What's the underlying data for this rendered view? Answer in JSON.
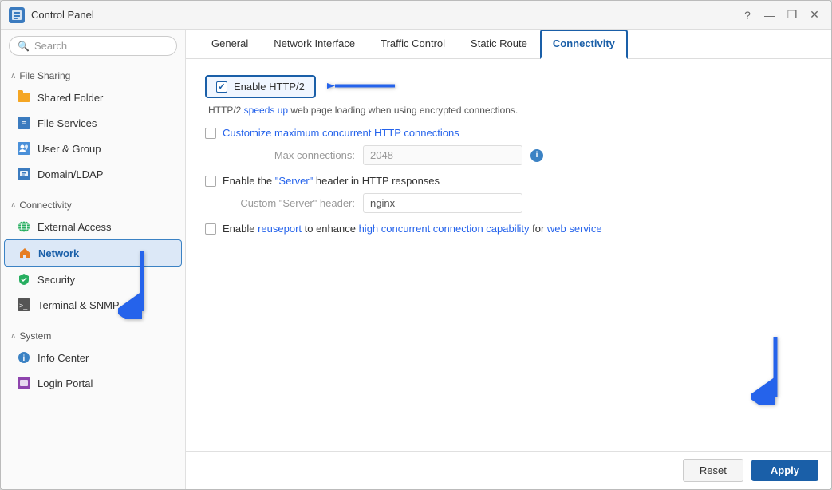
{
  "window": {
    "title": "Control Panel"
  },
  "titlebar_controls": {
    "help": "?",
    "minimize": "—",
    "maximize": "❐",
    "close": "✕"
  },
  "sidebar": {
    "search_placeholder": "Search",
    "sections": [
      {
        "label": "File Sharing",
        "expanded": true,
        "items": [
          {
            "id": "shared-folder",
            "label": "Shared Folder",
            "icon": "folder"
          },
          {
            "id": "file-services",
            "label": "File Services",
            "icon": "file-services"
          },
          {
            "id": "user-group",
            "label": "User & Group",
            "icon": "users"
          },
          {
            "id": "domain-ldap",
            "label": "Domain/LDAP",
            "icon": "domain"
          }
        ]
      },
      {
        "label": "Connectivity",
        "expanded": true,
        "items": [
          {
            "id": "external-access",
            "label": "External Access",
            "icon": "globe"
          },
          {
            "id": "network",
            "label": "Network",
            "icon": "house",
            "active": true
          },
          {
            "id": "security",
            "label": "Security",
            "icon": "shield"
          },
          {
            "id": "terminal-snmp",
            "label": "Terminal & SNMP",
            "icon": "terminal"
          }
        ]
      },
      {
        "label": "System",
        "expanded": true,
        "items": [
          {
            "id": "info-center",
            "label": "Info Center",
            "icon": "info"
          },
          {
            "id": "login-portal",
            "label": "Login Portal",
            "icon": "login"
          }
        ]
      }
    ]
  },
  "tabs": [
    {
      "id": "general",
      "label": "General",
      "active": false
    },
    {
      "id": "network-interface",
      "label": "Network Interface",
      "active": false
    },
    {
      "id": "traffic-control",
      "label": "Traffic Control",
      "active": false
    },
    {
      "id": "static-route",
      "label": "Static Route",
      "active": false
    },
    {
      "id": "connectivity",
      "label": "Connectivity",
      "active": true
    }
  ],
  "content": {
    "enable_http2": {
      "label": "Enable HTTP/2",
      "checked": true
    },
    "http2_description": "HTTP/2 speeds up web page loading when using encrypted connections.",
    "http2_description_highlight": "speeds up",
    "customize_http": {
      "label": "Customize maximum concurrent HTTP connections",
      "checked": false
    },
    "max_connections": {
      "label": "Max connections:",
      "value": "2048"
    },
    "server_header": {
      "label": "Enable the \"Server\" header in HTTP responses",
      "checked": false,
      "label_highlight": "Server"
    },
    "custom_server_label": "Custom \"Server\" header:",
    "custom_server_value": "nginx",
    "reuseport": {
      "label": "Enable reuseport to enhance high concurrent connection capability for web service",
      "checked": false,
      "label_highlights": [
        "reuseport",
        "high concurrent connection capability",
        "web service"
      ]
    }
  },
  "footer": {
    "reset_label": "Reset",
    "apply_label": "Apply"
  }
}
